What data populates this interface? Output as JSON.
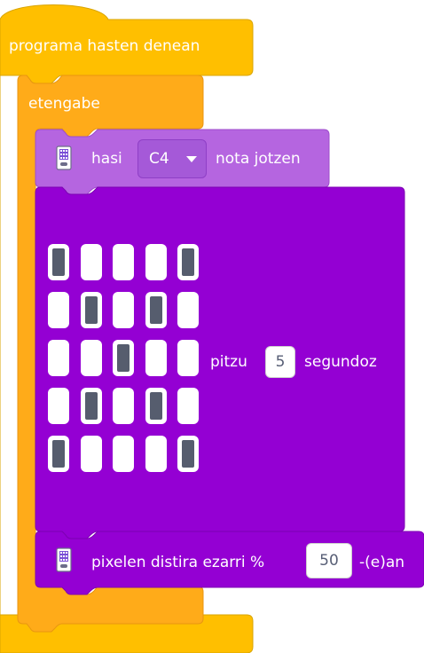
{
  "hat": {
    "label": "programa hasten denean"
  },
  "loop": {
    "label": "etengabe"
  },
  "note_block": {
    "prefix": "hasi",
    "note": "C4",
    "suffix": "nota jotzen"
  },
  "display_block": {
    "matrix": [
      [
        1,
        0,
        0,
        0,
        1
      ],
      [
        0,
        1,
        0,
        1,
        0
      ],
      [
        0,
        0,
        1,
        0,
        0
      ],
      [
        0,
        1,
        0,
        1,
        0
      ],
      [
        1,
        0,
        0,
        0,
        1
      ]
    ],
    "label_pre": "pitzu",
    "seconds": "5",
    "label_post": "segundoz"
  },
  "brightness_block": {
    "label_pre": "pixelen distira ezarri %",
    "value": "50",
    "label_post": "-(e)an"
  },
  "colors": {
    "events": "#ffbf00",
    "control": "#ffab19",
    "device": "#9966ff"
  }
}
